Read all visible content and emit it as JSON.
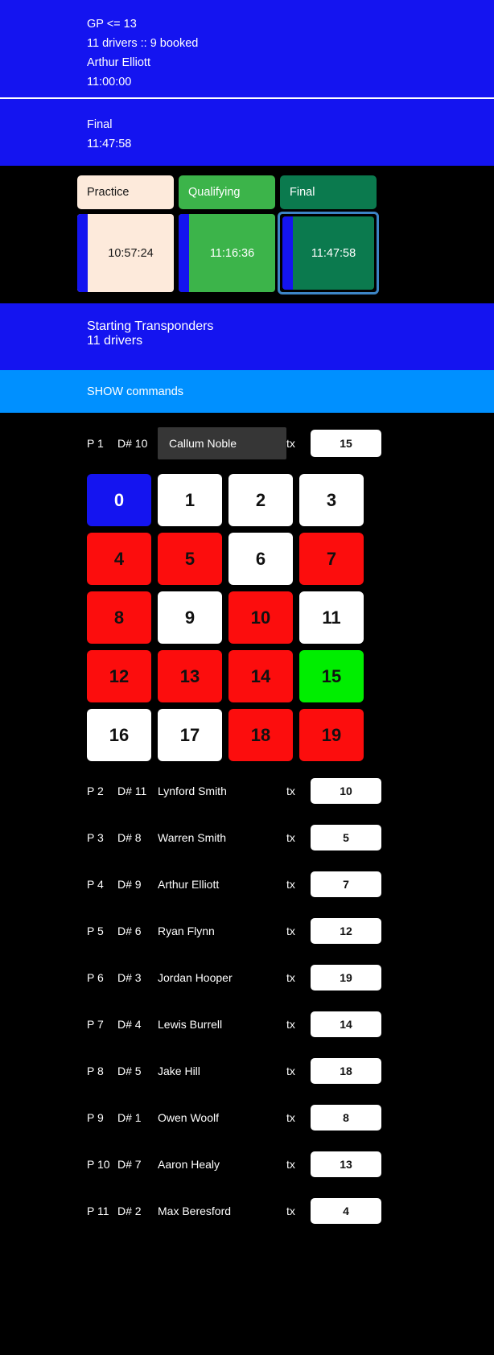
{
  "event_banner": {
    "gp_line": "GP <= 13",
    "drivers_line": "11 drivers :: 9 booked",
    "leader_line": "Arthur Elliott",
    "time_line": "11:00:00"
  },
  "session_banner": {
    "name": "Final",
    "time": "11:47:58"
  },
  "sessions": [
    {
      "label": "Practice",
      "time": "10:57:24",
      "style": "practice",
      "selected": false
    },
    {
      "label": "Qualifying",
      "time": "11:16:36",
      "style": "qualifying",
      "selected": false
    },
    {
      "label": "Final",
      "time": "11:47:58",
      "style": "final",
      "selected": true
    }
  ],
  "transponders_banner": {
    "title": "Starting Transponders",
    "count": "11 drivers"
  },
  "commands_banner": {
    "label": "SHOW commands"
  },
  "selected_driver": {
    "pos": "P 1",
    "dnum": "D# 10",
    "name": "Callum Noble",
    "tx_label": "tx",
    "tx": "15"
  },
  "tx_grid": {
    "cells": [
      {
        "n": "0",
        "state": "zero"
      },
      {
        "n": "1",
        "state": "free"
      },
      {
        "n": "2",
        "state": "free"
      },
      {
        "n": "3",
        "state": "free"
      },
      {
        "n": "4",
        "state": "taken"
      },
      {
        "n": "5",
        "state": "taken"
      },
      {
        "n": "6",
        "state": "free"
      },
      {
        "n": "7",
        "state": "taken"
      },
      {
        "n": "8",
        "state": "taken"
      },
      {
        "n": "9",
        "state": "free"
      },
      {
        "n": "10",
        "state": "taken"
      },
      {
        "n": "11",
        "state": "free"
      },
      {
        "n": "12",
        "state": "taken"
      },
      {
        "n": "13",
        "state": "taken"
      },
      {
        "n": "14",
        "state": "taken"
      },
      {
        "n": "15",
        "state": "current"
      },
      {
        "n": "16",
        "state": "free"
      },
      {
        "n": "17",
        "state": "free"
      },
      {
        "n": "18",
        "state": "taken"
      },
      {
        "n": "19",
        "state": "taken"
      }
    ]
  },
  "drivers": [
    {
      "pos": "P 2",
      "dnum": "D# 11",
      "name": "Lynford Smith",
      "tx_label": "tx",
      "tx": "10"
    },
    {
      "pos": "P 3",
      "dnum": "D# 8",
      "name": "Warren Smith",
      "tx_label": "tx",
      "tx": "5"
    },
    {
      "pos": "P 4",
      "dnum": "D# 9",
      "name": "Arthur Elliott",
      "tx_label": "tx",
      "tx": "7"
    },
    {
      "pos": "P 5",
      "dnum": "D# 6",
      "name": "Ryan Flynn",
      "tx_label": "tx",
      "tx": "12"
    },
    {
      "pos": "P 6",
      "dnum": "D# 3",
      "name": "Jordan Hooper",
      "tx_label": "tx",
      "tx": "19"
    },
    {
      "pos": "P 7",
      "dnum": "D# 4",
      "name": "Lewis Burrell",
      "tx_label": "tx",
      "tx": "14"
    },
    {
      "pos": "P 8",
      "dnum": "D# 5",
      "name": "Jake Hill",
      "tx_label": "tx",
      "tx": "18"
    },
    {
      "pos": "P 9",
      "dnum": "D# 1",
      "name": "Owen Woolf",
      "tx_label": "tx",
      "tx": "8"
    },
    {
      "pos": "P 10",
      "dnum": "D# 7",
      "name": "Aaron Healy",
      "tx_label": "tx",
      "tx": "13"
    },
    {
      "pos": "P 11",
      "dnum": "D# 2",
      "name": "Max Beresford",
      "tx_label": "tx",
      "tx": "4"
    }
  ],
  "colors": {
    "banner_blue": "#1414f0",
    "command_blue": "#0090ff",
    "taken_red": "#fc0d0d",
    "current_green": "#00ee00",
    "practice_cream": "#fdeadb",
    "qualifying_green": "#3cb44a",
    "final_green": "#0b7a4e",
    "selection_ring": "#3d85c6"
  }
}
